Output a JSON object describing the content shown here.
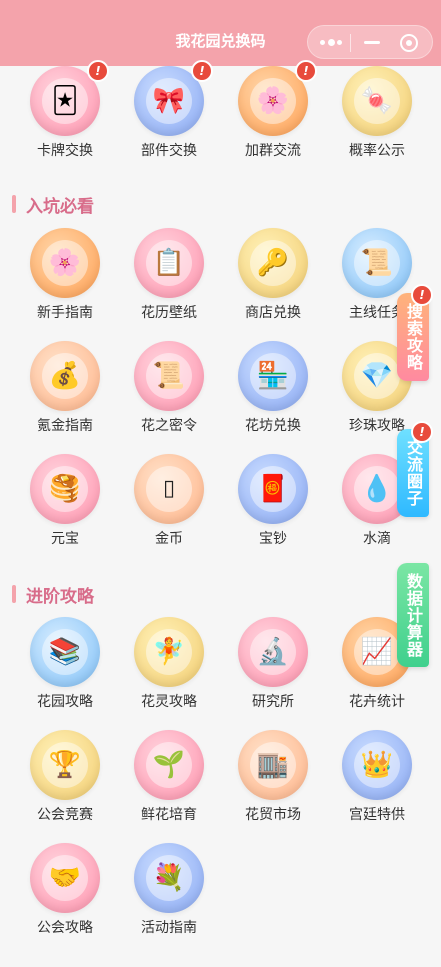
{
  "header": {
    "title": "我花园兑换码"
  },
  "sections": {
    "beginner": "入坑必看",
    "advanced": "进阶攻略"
  },
  "items": [
    {
      "label": "卡牌交换",
      "icon": "card-icon",
      "glyph": "🃏",
      "theme": "pink",
      "badge": "!"
    },
    {
      "label": "部件交换",
      "icon": "bow-icon",
      "glyph": "🎀",
      "theme": "blue",
      "badge": "!"
    },
    {
      "label": "加群交流",
      "icon": "flower-icon",
      "glyph": "🌸",
      "theme": "orange",
      "badge": "!"
    },
    {
      "label": "概率公示",
      "icon": "candy-icon",
      "glyph": "🍬",
      "theme": "yellow"
    },
    {
      "label": "新手指南",
      "icon": "flower-icon",
      "glyph": "🌸",
      "theme": "orange"
    },
    {
      "label": "花历壁纸",
      "icon": "clipboard-icon",
      "glyph": "📋",
      "theme": "pink"
    },
    {
      "label": "商店兑换",
      "icon": "key-icon",
      "glyph": "🔑",
      "theme": "yellow"
    },
    {
      "label": "主线任务",
      "icon": "scroll-icon",
      "glyph": "📜",
      "theme": "sky"
    },
    {
      "label": "氪金指南",
      "icon": "money-bag-icon",
      "glyph": "💰",
      "theme": "peach"
    },
    {
      "label": "花之密令",
      "icon": "scroll-icon",
      "glyph": "📜",
      "theme": "pink"
    },
    {
      "label": "花坊兑换",
      "icon": "shop-icon",
      "glyph": "🏪",
      "theme": "blue"
    },
    {
      "label": "珍珠攻略",
      "icon": "gem-icon",
      "glyph": "💎",
      "theme": "yellow"
    },
    {
      "label": "元宝",
      "icon": "pancake-icon",
      "glyph": "🥞",
      "theme": "pink"
    },
    {
      "label": "金币",
      "icon": "coin-icon",
      "glyph": "▯",
      "theme": "peach"
    },
    {
      "label": "宝钞",
      "icon": "red-envelope-icon",
      "glyph": "🧧",
      "theme": "blue"
    },
    {
      "label": "水滴",
      "icon": "droplet-icon",
      "glyph": "💧",
      "theme": "pink"
    },
    {
      "label": "花园攻略",
      "icon": "books-icon",
      "glyph": "📚",
      "theme": "sky"
    },
    {
      "label": "花灵攻略",
      "icon": "fairy-icon",
      "glyph": "🧚",
      "theme": "yellow"
    },
    {
      "label": "研究所",
      "icon": "microscope-icon",
      "glyph": "🔬",
      "theme": "pink"
    },
    {
      "label": "花卉统计",
      "icon": "chart-icon",
      "glyph": "📈",
      "theme": "orange"
    },
    {
      "label": "公会竞赛",
      "icon": "trophy-icon",
      "glyph": "🏆",
      "theme": "yellow"
    },
    {
      "label": "鲜花培育",
      "icon": "sprout-icon",
      "glyph": "🌱",
      "theme": "pink"
    },
    {
      "label": "花贸市场",
      "icon": "building-icon",
      "glyph": "🏬",
      "theme": "peach"
    },
    {
      "label": "宫廷特供",
      "icon": "crown-icon",
      "glyph": "👑",
      "theme": "blue"
    },
    {
      "label": "公会攻略",
      "icon": "handshake-icon",
      "glyph": "🤝",
      "theme": "pink"
    },
    {
      "label": "活动指南",
      "icon": "bouquet-icon",
      "glyph": "💐",
      "theme": "blue"
    }
  ],
  "floating_tabs": [
    {
      "label": "搜索攻略",
      "color_from": "#ffb37a",
      "color_to": "#ff8aa0",
      "badge": "!"
    },
    {
      "label": "交流圈子",
      "color_from": "#4fd6ff",
      "color_to": "#2fb9ff",
      "badge": "!"
    },
    {
      "label": "数据计算器",
      "color_from": "#7be6a4",
      "color_to": "#3fd08d"
    }
  ]
}
